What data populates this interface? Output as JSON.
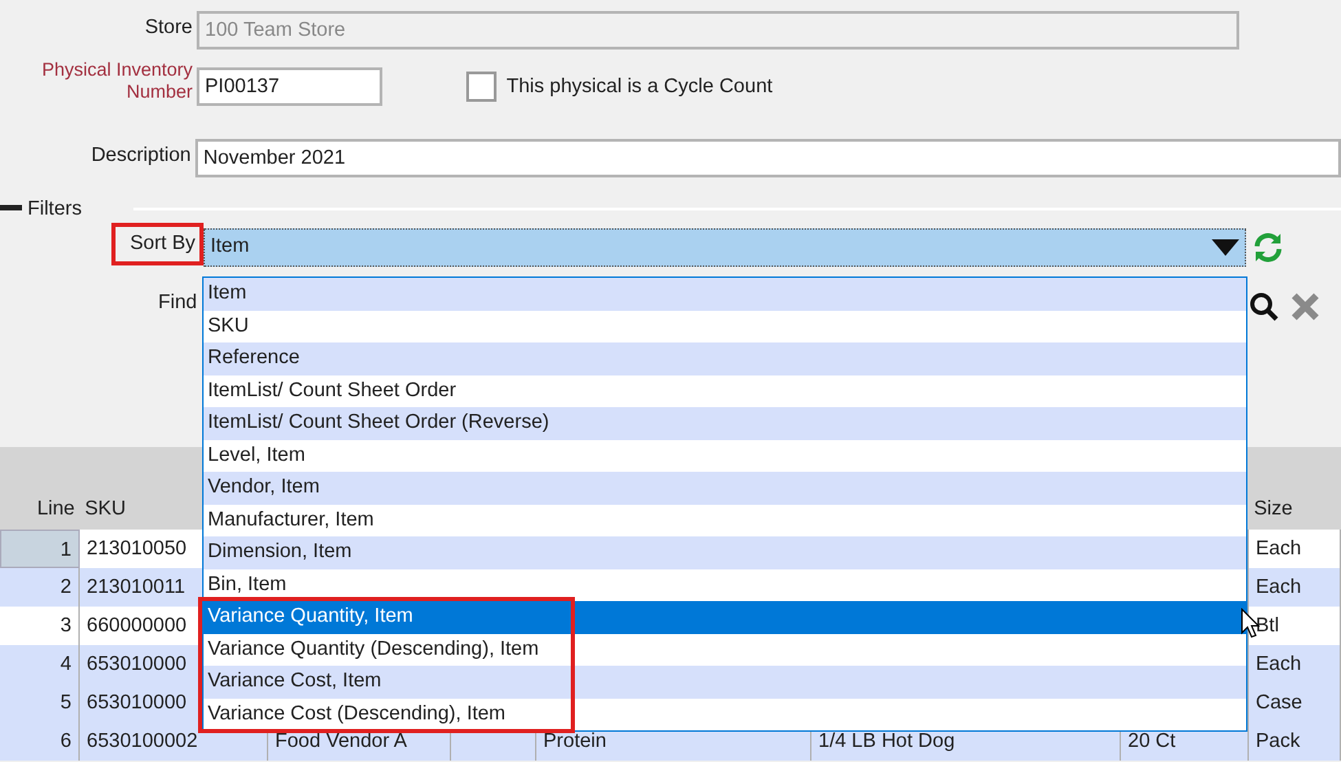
{
  "form": {
    "store": {
      "label": "Store",
      "value": "100 Team Store",
      "disabled": true
    },
    "number": {
      "label": "Physical Inventory Number",
      "value": "PI00137",
      "required": true
    },
    "cycle_count": {
      "label": "This physical is a Cycle Count",
      "checked": false
    },
    "description": {
      "label": "Description",
      "value": "November 2021"
    }
  },
  "filters": {
    "title": "Filters",
    "expanded": true,
    "sort_by": {
      "label": "Sort By",
      "value": "Item",
      "callout": true,
      "expanded": true
    },
    "find": {
      "label": "Find"
    }
  },
  "sort_options": [
    {
      "label": "Item",
      "selected": false,
      "callout": false
    },
    {
      "label": "SKU",
      "selected": false,
      "callout": false
    },
    {
      "label": "Reference",
      "selected": false,
      "callout": false
    },
    {
      "label": "ItemList/ Count Sheet Order",
      "selected": false,
      "callout": false
    },
    {
      "label": "ItemList/ Count Sheet Order (Reverse)",
      "selected": false,
      "callout": false
    },
    {
      "label": "Level, Item",
      "selected": false,
      "callout": false
    },
    {
      "label": "Vendor, Item",
      "selected": false,
      "callout": false
    },
    {
      "label": "Manufacturer, Item",
      "selected": false,
      "callout": false
    },
    {
      "label": "Dimension, Item",
      "selected": false,
      "callout": false
    },
    {
      "label": "Bin, Item",
      "selected": false,
      "callout": false
    },
    {
      "label": "Variance Quantity, Item",
      "selected": true,
      "callout": true
    },
    {
      "label": "Variance Quantity (Descending), Item",
      "selected": false,
      "callout": true
    },
    {
      "label": "Variance Cost, Item",
      "selected": false,
      "callout": true
    },
    {
      "label": "Variance Cost (Descending), Item",
      "selected": false,
      "callout": true
    }
  ],
  "table": {
    "header": {
      "line": "Line",
      "sku": "SKU",
      "size": "Size"
    },
    "rows": [
      {
        "line": "1",
        "sku": "213010050",
        "size": "Each",
        "highlighted": false,
        "current": true
      },
      {
        "line": "2",
        "sku": "213010011",
        "size": "Each",
        "highlighted": true,
        "current": false
      },
      {
        "line": "3",
        "sku": "660000000",
        "size": "Btl",
        "highlighted": false,
        "current": false
      },
      {
        "line": "4",
        "sku": "653010000",
        "size": "Each",
        "highlighted": true,
        "current": false
      },
      {
        "line": "5",
        "sku": "653010000",
        "size": "Case",
        "highlighted": true,
        "current": false
      },
      {
        "line": "6",
        "sku": "6530100002",
        "column_3": "Food Vendor A",
        "column_5": "Protein",
        "column_6": "1/4 LB Hot Dog",
        "column_7": "20 Ct",
        "size": "Pack",
        "highlighted": true,
        "current": false
      }
    ]
  }
}
